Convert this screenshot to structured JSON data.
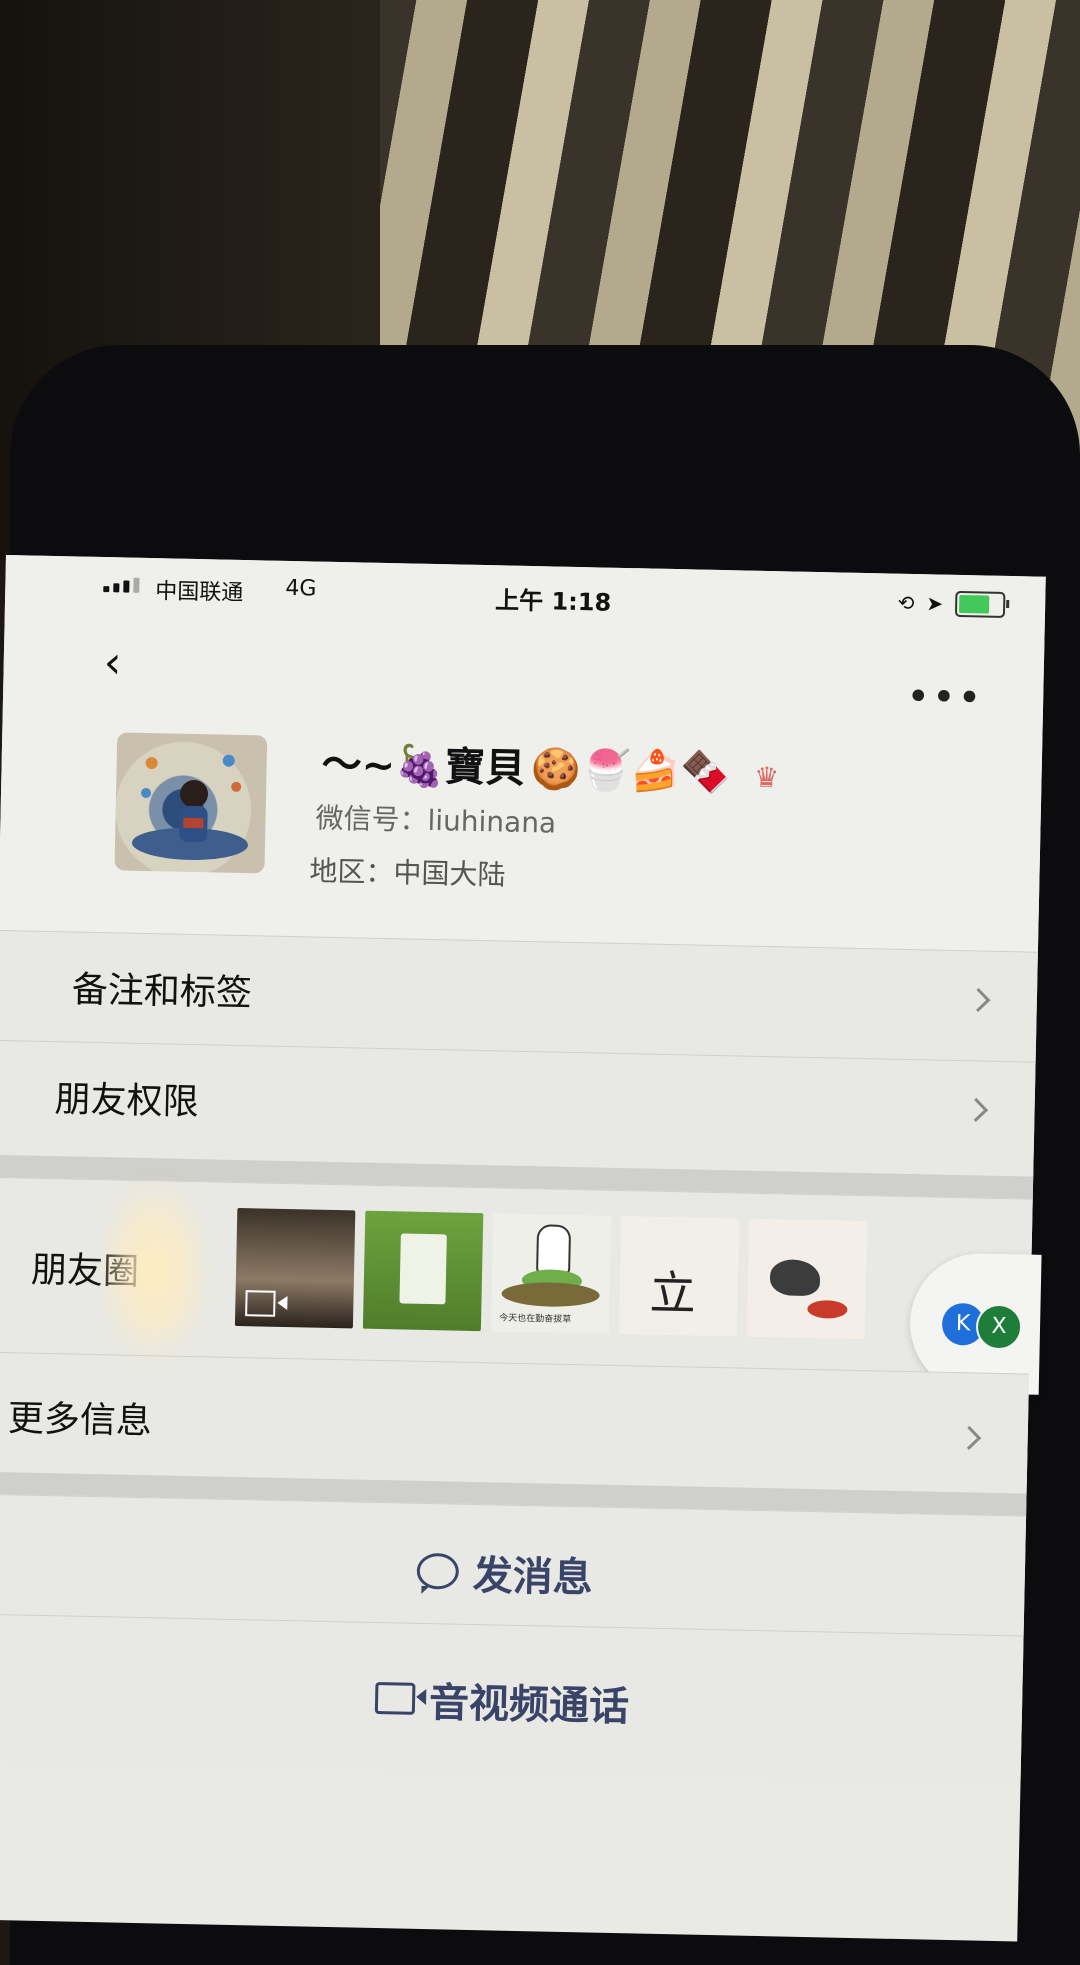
{
  "status_bar": {
    "carrier": "中国联通",
    "network": "4G",
    "time": "上午 1:18"
  },
  "header": {
    "back_icon": "chevron-left-icon",
    "more_label": "•••"
  },
  "profile": {
    "nickname_text": "〜~",
    "nickname_name": "寶貝",
    "nickname_emojis": [
      "🍇",
      "🍪",
      "🍧",
      "🍰",
      "🍫"
    ],
    "wxid_label": "微信号：",
    "wxid_value": "liuhinana",
    "region_label": "地区：",
    "region_value": "中国大陆"
  },
  "rows": {
    "remarks_tags": "备注和标签",
    "friend_permissions": "朋友权限",
    "moments": "朋友圈",
    "more_info": "更多信息"
  },
  "moments_thumbs": {
    "thumb3_caption": "今天也在勤奋拔草",
    "thumb4_text": "立春"
  },
  "floating_pill": {
    "badge_a": "K",
    "badge_b": "X"
  },
  "actions": {
    "send_message": "发消息",
    "av_call": "音视频通话"
  }
}
